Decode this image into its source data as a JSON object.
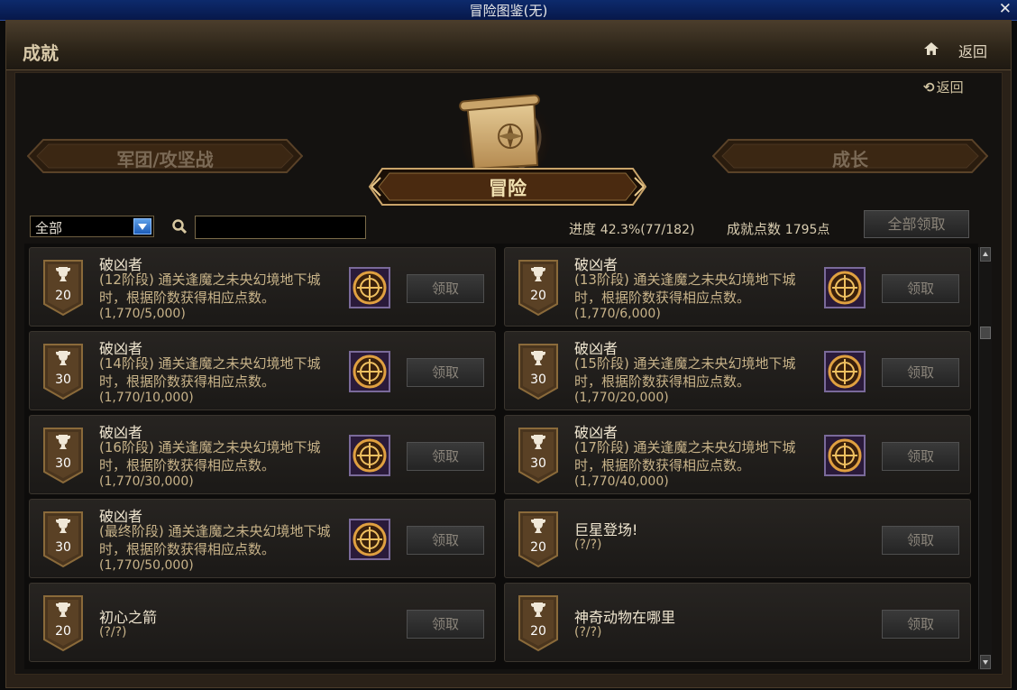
{
  "window": {
    "title": "冒险图鉴(无)",
    "close_label": "✕"
  },
  "header": {
    "title": "成就",
    "back_label": "返回"
  },
  "nav": {
    "back_label": "返回"
  },
  "tabs": [
    {
      "label": "军团/攻坚战",
      "active": false
    },
    {
      "label": "冒险",
      "active": true
    },
    {
      "label": "成长",
      "active": false
    }
  ],
  "filter": {
    "selected": "全部"
  },
  "search": {
    "placeholder": ""
  },
  "stats": {
    "progress_label": "进度",
    "progress_value": "42.3%(77/182)",
    "points_label": "成就点数",
    "points_value": "1795点"
  },
  "claim_all_label": "全部领取",
  "achievements": [
    {
      "name": "破凶者",
      "points": "20",
      "desc": "(12阶段) 通关逢魔之未央幻境地下城时，根据阶数获得相应点数。",
      "progress": "(1,770/5,000)",
      "has_reward": true,
      "claim_label": "领取"
    },
    {
      "name": "破凶者",
      "points": "20",
      "desc": "(13阶段) 通关逢魔之未央幻境地下城时，根据阶数获得相应点数。",
      "progress": "(1,770/6,000)",
      "has_reward": true,
      "claim_label": "领取"
    },
    {
      "name": "破凶者",
      "points": "30",
      "desc": "(14阶段) 通关逢魔之未央幻境地下城时，根据阶数获得相应点数。",
      "progress": "(1,770/10,000)",
      "has_reward": true,
      "claim_label": "领取"
    },
    {
      "name": "破凶者",
      "points": "30",
      "desc": "(15阶段) 通关逢魔之未央幻境地下城时，根据阶数获得相应点数。",
      "progress": "(1,770/20,000)",
      "has_reward": true,
      "claim_label": "领取"
    },
    {
      "name": "破凶者",
      "points": "30",
      "desc": "(16阶段) 通关逢魔之未央幻境地下城时，根据阶数获得相应点数。",
      "progress": "(1,770/30,000)",
      "has_reward": true,
      "claim_label": "领取"
    },
    {
      "name": "破凶者",
      "points": "30",
      "desc": "(17阶段) 通关逢魔之未央幻境地下城时，根据阶数获得相应点数。",
      "progress": "(1,770/40,000)",
      "has_reward": true,
      "claim_label": "领取"
    },
    {
      "name": "破凶者",
      "points": "30",
      "desc": "(最终阶段) 通关逢魔之未央幻境地下城时，根据阶数获得相应点数。",
      "progress": "(1,770/50,000)",
      "has_reward": true,
      "claim_label": "领取"
    },
    {
      "name": "巨星登场!",
      "points": "20",
      "desc": "",
      "progress": "(?/?)",
      "has_reward": false,
      "claim_label": "领取"
    },
    {
      "name": "初心之箭",
      "points": "20",
      "desc": "",
      "progress": "(?/?)",
      "has_reward": false,
      "claim_label": "领取"
    },
    {
      "name": "神奇动物在哪里",
      "points": "20",
      "desc": "",
      "progress": "(?/?)",
      "has_reward": false,
      "claim_label": "领取"
    }
  ],
  "colors": {
    "accent_gold": "#c8b389",
    "title_bar": "#0d2a6c",
    "panel": "#1b1917"
  },
  "icons": [
    "home-icon",
    "back-arrow-icon",
    "search-icon",
    "trophy-icon",
    "reward-emblem-icon",
    "scroll-compass-icon",
    "dropdown-arrow-icon"
  ]
}
